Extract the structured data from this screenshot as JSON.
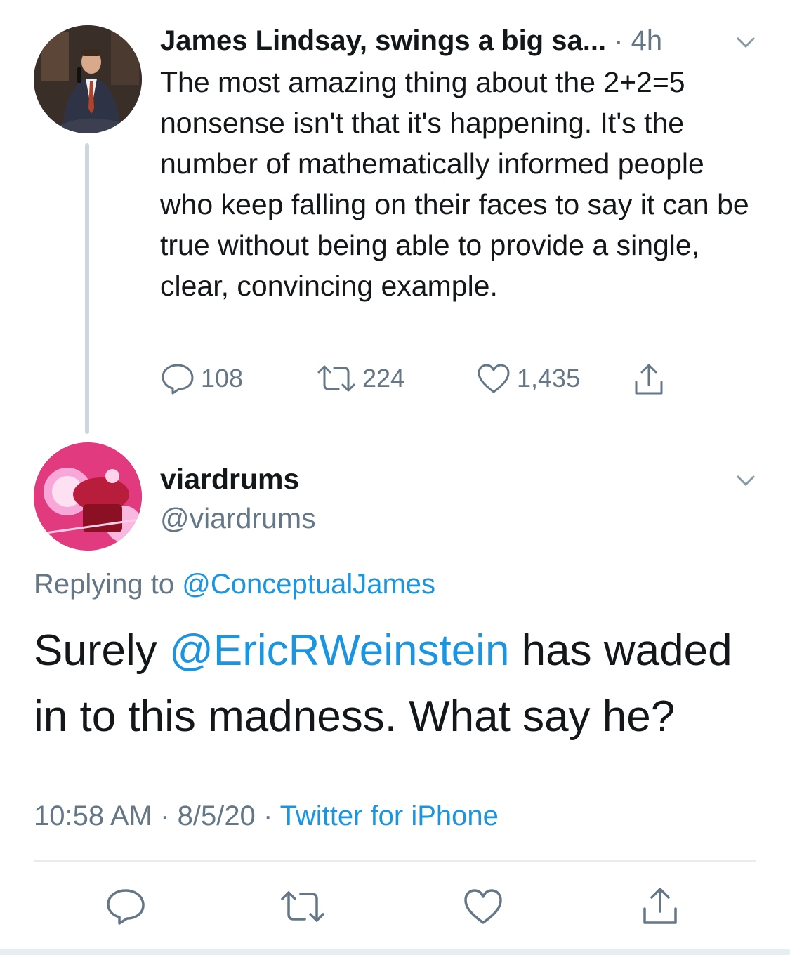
{
  "parent_tweet": {
    "author_name": "James Lindsay, swings a big sa...",
    "separator": "·",
    "time_ago": "4h",
    "text": "The most amazing thing about the 2+2=5 nonsense isn't that it's happening. It's the number of mathematically informed people who keep falling on their faces to say it can be true without being able to provide a single, clear, convincing example.",
    "replies": "108",
    "retweets": "224",
    "likes": "1,435"
  },
  "reply_tweet": {
    "author_name": "viardrums",
    "handle": "@viardrums",
    "replying_label": "Replying to",
    "replying_handle": "@ConceptualJames",
    "text_before": "Surely ",
    "mention": "@EricRWeinstein",
    "text_after": " has waded in to this madness. What say he?",
    "time": "10:58 AM",
    "sep1": "·",
    "date": "8/5/20",
    "sep2": "·",
    "source": "Twitter for iPhone"
  },
  "colors": {
    "link": "#1b95e0",
    "muted": "#657786",
    "text": "#14171a",
    "divider": "#e6ecf0"
  },
  "icons": [
    "reply-icon",
    "retweet-icon",
    "like-icon",
    "share-icon",
    "chevron-down-icon"
  ]
}
